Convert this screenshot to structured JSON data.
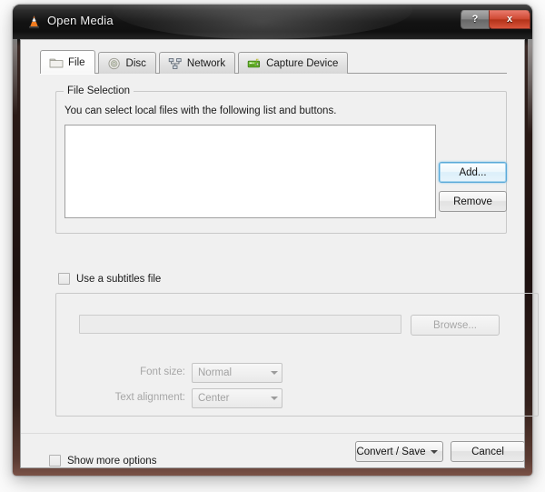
{
  "window": {
    "title": "Open Media",
    "app_icon": "vlc-cone-icon",
    "help_label": "?",
    "close_label": "x",
    "accent_focus_color": "#5aa9d8",
    "close_button_color": "#cf4a33"
  },
  "tabs": [
    {
      "label": "File",
      "icon": "folder-icon",
      "selected": true
    },
    {
      "label": "Disc",
      "icon": "disc-icon",
      "selected": false
    },
    {
      "label": "Network",
      "icon": "network-icon",
      "selected": false
    },
    {
      "label": "Capture Device",
      "icon": "capture-card-icon",
      "selected": false
    }
  ],
  "file_selection": {
    "group_title": "File Selection",
    "hint": "You can select local files with the following list and buttons.",
    "list_items": [],
    "add_label": "Add...",
    "remove_label": "Remove"
  },
  "subtitles": {
    "use_subtitles_label": "Use a subtitles file",
    "use_subtitles_checked": false,
    "path_value": "",
    "path_placeholder": "",
    "browse_label": "Browse...",
    "font_size_label": "Font size:",
    "font_size_value": "Normal",
    "font_size_options": [
      "Normal"
    ],
    "text_alignment_label": "Text alignment:",
    "text_alignment_value": "Center",
    "text_alignment_options": [
      "Center"
    ]
  },
  "footer": {
    "show_more_label": "Show more options",
    "show_more_checked": false,
    "convert_save_label": "Convert / Save",
    "convert_save_menu_icon": "chevron-down-icon",
    "cancel_label": "Cancel"
  }
}
